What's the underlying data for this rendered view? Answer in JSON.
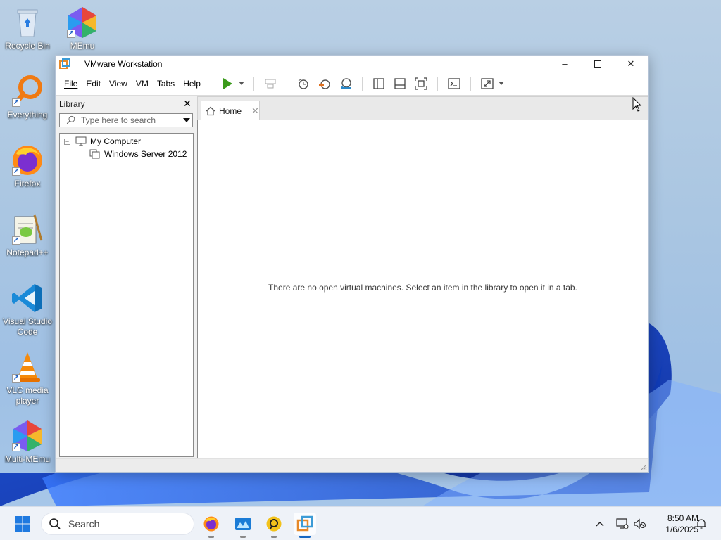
{
  "desktop": {
    "icons": [
      {
        "label": "Recycle Bin",
        "icon": "recycle-bin-icon"
      },
      {
        "label": "MEmu",
        "icon": "memu-icon"
      },
      {
        "label": "Everything",
        "icon": "everything-icon"
      },
      {
        "label": "Firefox",
        "icon": "firefox-icon"
      },
      {
        "label": "Notepad++",
        "icon": "notepad-plus-plus-icon"
      },
      {
        "label": "Visual Studio Code",
        "icon": "vscode-icon"
      },
      {
        "label": "VLC media player",
        "icon": "vlc-icon"
      },
      {
        "label": "Multi-MEmu",
        "icon": "multi-memu-icon"
      }
    ]
  },
  "window": {
    "title": "VMware Workstation",
    "controls": {
      "minimize": "–",
      "maximize": "☐",
      "close": "✕"
    }
  },
  "menubar": {
    "items": [
      "File",
      "Edit",
      "View",
      "VM",
      "Tabs",
      "Help"
    ]
  },
  "toolbar": {
    "buttons": [
      "play-icon",
      "send-ctrl-alt-del-icon",
      "snapshot-icon",
      "revert-snapshot-icon",
      "snapshot-manager-icon",
      "show-library-icon",
      "thumbnail-bar-icon",
      "full-screen-icon",
      "console-view-icon",
      "stretch-guest-icon"
    ]
  },
  "library": {
    "title": "Library",
    "close": "✕",
    "search_placeholder": "Type here to search",
    "tree": {
      "root": "My Computer",
      "expander": "−",
      "children": [
        "Windows Server 2012"
      ]
    }
  },
  "tabs": [
    {
      "label": "Home",
      "close": "✕"
    }
  ],
  "home": {
    "message": "There are no open virtual machines. Select an item in the library to open it in a tab."
  },
  "taskbar": {
    "search_label": "Search",
    "apps": [
      "firefox-icon",
      "memu-taskbar-icon",
      "anydesk-like-icon",
      "vmware-taskbar-icon"
    ],
    "clock": {
      "time": "8:50 AM",
      "date": "1/6/2025"
    }
  },
  "colors": {
    "accent": "#1466c2",
    "play_green": "#3a9a1a",
    "vmware_orange": "#e6892a"
  }
}
